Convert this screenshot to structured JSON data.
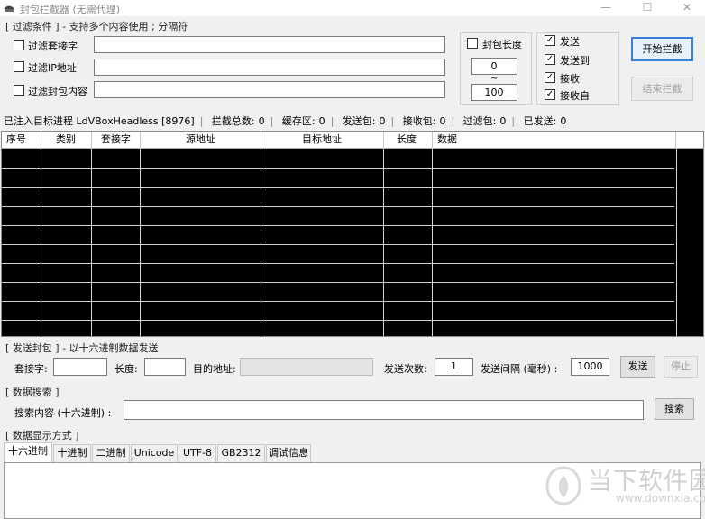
{
  "window": {
    "title": "封包拦截器 (无需代理)",
    "controls": {
      "minimize": "—",
      "maximize": "☐",
      "close": "✕"
    }
  },
  "filter": {
    "legend": "[ 过滤条件 ] - 支持多个内容使用 ; 分隔符",
    "rows": [
      {
        "label": "过滤套接字",
        "checked": false,
        "value": ""
      },
      {
        "label": "过滤IP地址",
        "checked": false,
        "value": ""
      },
      {
        "label": "过滤封包内容",
        "checked": false,
        "value": ""
      }
    ],
    "length": {
      "label": "封包长度",
      "checked": false,
      "min": "0",
      "tilde": "~",
      "max": "100"
    }
  },
  "options": [
    {
      "label": "发送",
      "checked": true
    },
    {
      "label": "发送到",
      "checked": true
    },
    {
      "label": "接收",
      "checked": true
    },
    {
      "label": "接收自",
      "checked": true
    }
  ],
  "buttons": {
    "start": "开始拦截",
    "stop": "结束拦截"
  },
  "status": {
    "injected": "已注入目标进程 LdVBoxHeadless [8976]",
    "items": [
      {
        "label": "拦截总数:",
        "value": "0"
      },
      {
        "label": "缓存区:",
        "value": "0"
      },
      {
        "label": "发送包:",
        "value": "0"
      },
      {
        "label": "接收包:",
        "value": "0"
      },
      {
        "label": "过滤包:",
        "value": "0"
      },
      {
        "label": "已发送:",
        "value": "0"
      }
    ]
  },
  "table": {
    "columns": [
      "序号",
      "类别",
      "套接字",
      "源地址",
      "目标地址",
      "长度",
      "数据"
    ]
  },
  "send": {
    "legend": "[ 发送封包 ] - 以十六进制数据发送",
    "socket_label": "套接字:",
    "socket_value": "",
    "length_label": "长度:",
    "length_value": "",
    "dest_label": "目的地址:",
    "dest_value": "",
    "count_label": "发送次数:",
    "count_value": "1",
    "interval_label": "发送间隔 (毫秒) :",
    "interval_value": "1000",
    "send_button": "发送",
    "stop_button": "停止"
  },
  "search": {
    "legend": "[ 数据搜索 ]",
    "label": "搜索内容 (十六进制) :",
    "value": "",
    "button": "搜索"
  },
  "display": {
    "legend": "[ 数据显示方式 ]",
    "tabs": [
      "十六进制",
      "十进制",
      "二进制",
      "Unicode",
      "UTF-8",
      "GB2312",
      "调试信息"
    ],
    "active_tab": 0
  },
  "watermark": {
    "brand": "当下软件园",
    "url": "www.downxia.com"
  },
  "colors": {
    "accent": "#3c7fd6",
    "watermark": "#d0d0d0",
    "table_bg": "#000000"
  }
}
